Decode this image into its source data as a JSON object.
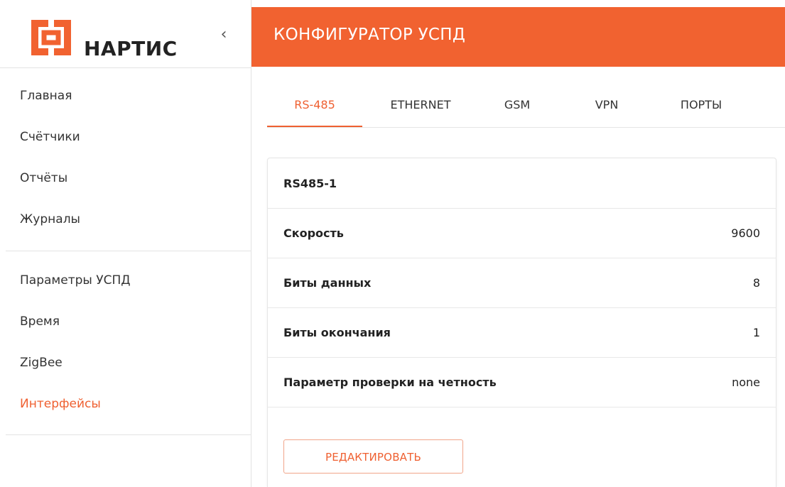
{
  "brand": {
    "name": "НАРТИС",
    "accent_color": "#f16230",
    "collapse_icon": "chevron-left-icon"
  },
  "header": {
    "title": "КОНФИГУРАТОР УСПД"
  },
  "sidebar": {
    "groups": [
      {
        "items": [
          {
            "label": "Главная",
            "active": false
          },
          {
            "label": "Счётчики",
            "active": false
          },
          {
            "label": "Отчёты",
            "active": false
          },
          {
            "label": "Журналы",
            "active": false
          }
        ]
      },
      {
        "items": [
          {
            "label": "Параметры УСПД",
            "active": false
          },
          {
            "label": "Время",
            "active": false
          },
          {
            "label": "ZigBee",
            "active": false
          },
          {
            "label": "Интерфейсы",
            "active": true
          }
        ]
      }
    ]
  },
  "tabs": [
    {
      "label": "RS-485",
      "active": true
    },
    {
      "label": "ETHERNET",
      "active": false
    },
    {
      "label": "GSM",
      "active": false
    },
    {
      "label": "VPN",
      "active": false
    },
    {
      "label": "ПОРТЫ",
      "active": false
    }
  ],
  "card": {
    "title": "RS485-1",
    "rows": [
      {
        "label": "Скорость",
        "value": "9600"
      },
      {
        "label": "Биты данных",
        "value": "8"
      },
      {
        "label": "Биты окончания",
        "value": "1"
      },
      {
        "label": "Параметр проверки на четность",
        "value": "none"
      }
    ],
    "edit_label": "РЕДАКТИРОВАТЬ"
  }
}
